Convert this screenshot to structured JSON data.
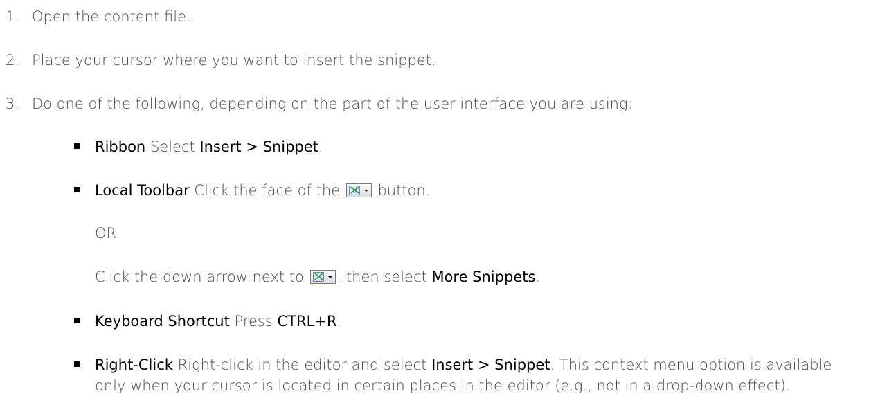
{
  "steps": [
    {
      "number": "1.",
      "text": "Open the content file."
    },
    {
      "number": "2.",
      "text": "Place your cursor where you want to insert the snippet."
    },
    {
      "number": "3.",
      "text": "Do one of the following, depending on the part of the user interface you are using:"
    }
  ],
  "options": {
    "ribbon": {
      "label": "Ribbon",
      "text_before": "Select",
      "command": "Insert > Snippet",
      "text_after": "."
    },
    "local_toolbar": {
      "label": "Local Toolbar",
      "text_before": "Click the face of the",
      "text_after": "button.",
      "or": "OR",
      "alt_text_before": "Click the down arrow next to",
      "alt_text_middle": ", then select",
      "alt_command": "More Snippets",
      "alt_text_after": "."
    },
    "keyboard": {
      "label": "Keyboard Shortcut",
      "text_before": "Press",
      "shortcut": "CTRL+R",
      "text_after": "."
    },
    "right_click": {
      "label": "Right-Click",
      "text_before": "Right-click in the editor and select",
      "command": "Insert > Snippet",
      "text_after": ". This context menu option is available only when your cursor is located in certain places in the editor (e.g., not in a drop-down effect)."
    }
  },
  "icons": {
    "snippet_button": "insert-snippet-icon"
  },
  "colors": {
    "body_text": "#4a4a4a",
    "emphasis_text": "#000000"
  }
}
